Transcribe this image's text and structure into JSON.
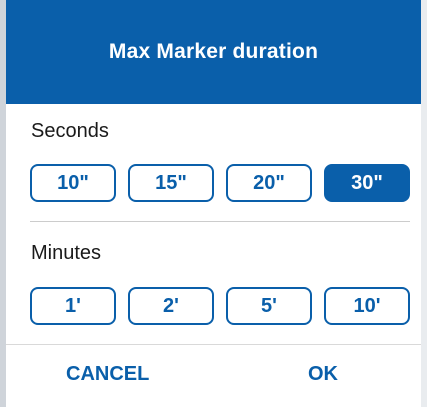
{
  "dialog": {
    "title": "Max Marker duration",
    "accent_color": "#0a5faa"
  },
  "seconds": {
    "label": "Seconds",
    "options": [
      "10\"",
      "15\"",
      "20\"",
      "30\""
    ],
    "selected": "30\""
  },
  "minutes": {
    "label": "Minutes",
    "options": [
      "1'",
      "2'",
      "5'",
      "10'"
    ],
    "selected": null
  },
  "footer": {
    "cancel_label": "CANCEL",
    "ok_label": "OK"
  }
}
